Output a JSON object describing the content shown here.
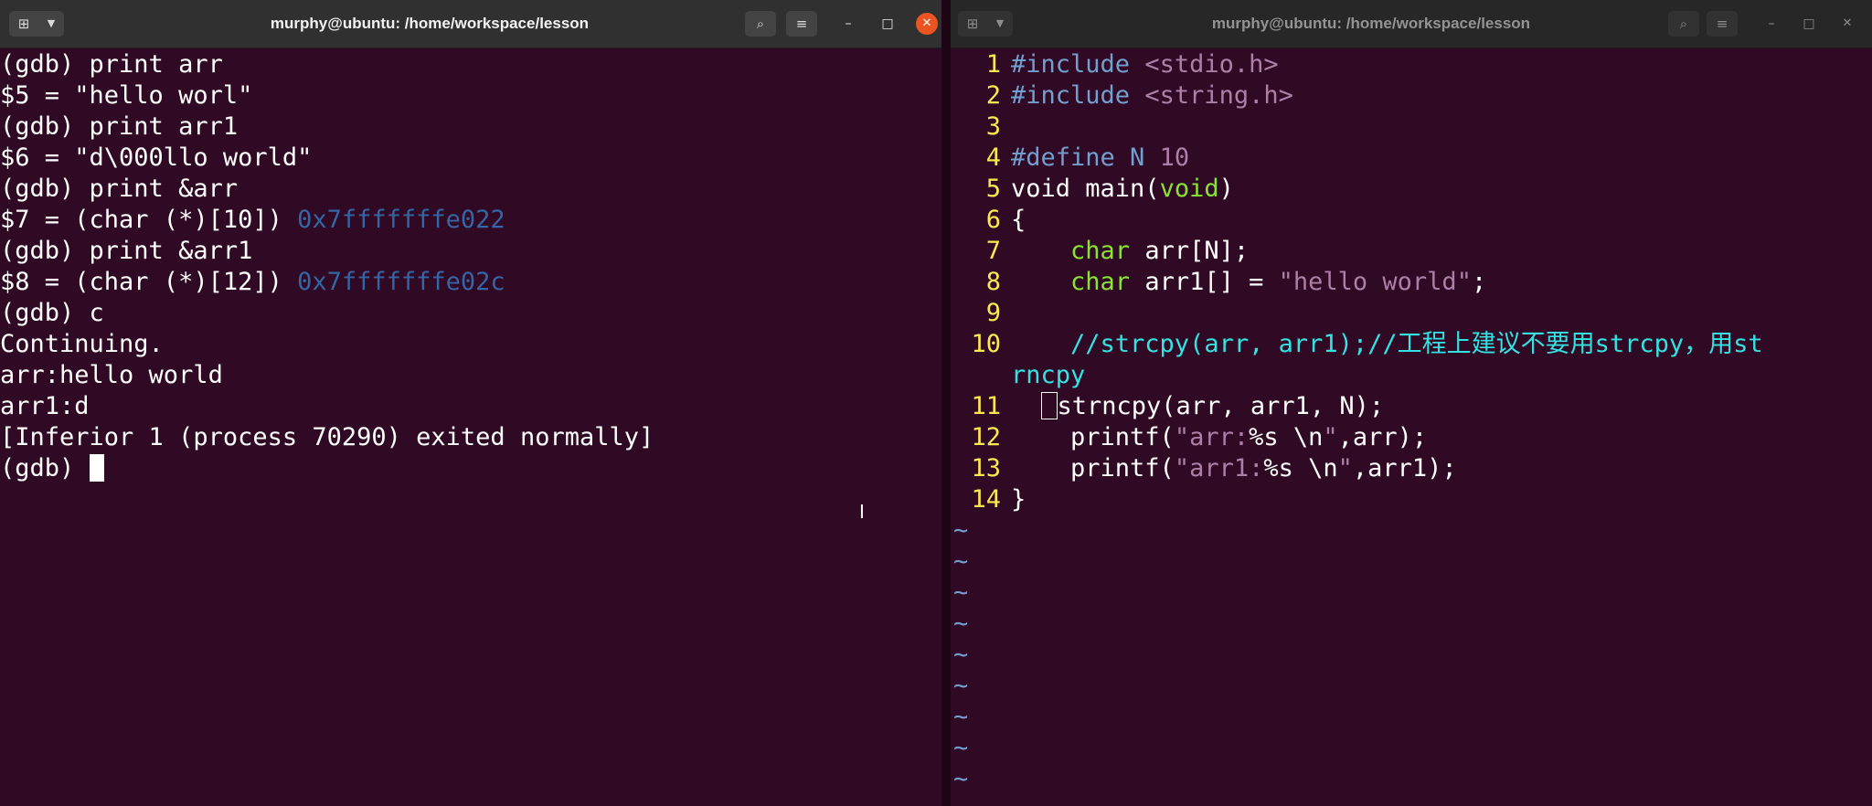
{
  "left_window": {
    "title": "murphy@ubuntu: /home/workspace/lesson",
    "buttons": {
      "new_tab_icon": "new-tab-icon",
      "menu_arrow_icon": "chevron-down-icon",
      "search_icon": "search-icon",
      "hamburger_icon": "hamburger-menu-icon",
      "minimize": "–",
      "maximize": "□",
      "close": "✕"
    },
    "terminal_lines": [
      {
        "text": "(gdb) print arr"
      },
      {
        "text": "$5 = \"hello worl\""
      },
      {
        "text": "(gdb) print arr1"
      },
      {
        "text": "$6 = \"d\\000llo world\""
      },
      {
        "text": "(gdb) print &arr"
      },
      {
        "text": "$7 = (char (*)[10]) ",
        "addr": "0x7fffffffe022"
      },
      {
        "text": "(gdb) print &arr1"
      },
      {
        "text": "$8 = (char (*)[12]) ",
        "addr": "0x7fffffffe02c"
      },
      {
        "text": "(gdb) c"
      },
      {
        "text": "Continuing."
      },
      {
        "text": "arr:hello world"
      },
      {
        "text": "arr1:d"
      },
      {
        "text": "[Inferior 1 (process 70290) exited normally]"
      }
    ],
    "prompt": "(gdb) "
  },
  "right_window": {
    "title": "murphy@ubuntu: /home/workspace/lesson",
    "buttons": {
      "minimize": "–",
      "maximize": "□",
      "close": "✕"
    },
    "code_lines": [
      {
        "num": "1",
        "segments": [
          {
            "cls": "pp",
            "t": "#include "
          },
          {
            "cls": "str",
            "t": "<stdio.h>"
          }
        ]
      },
      {
        "num": "2",
        "segments": [
          {
            "cls": "pp",
            "t": "#include "
          },
          {
            "cls": "str",
            "t": "<string.h>"
          }
        ]
      },
      {
        "num": "3",
        "segments": []
      },
      {
        "num": "4",
        "segments": [
          {
            "cls": "pp",
            "t": "#define N "
          },
          {
            "cls": "str",
            "t": "10"
          }
        ]
      },
      {
        "num": "5",
        "segments": [
          {
            "cls": "",
            "t": "void main("
          },
          {
            "cls": "kw",
            "t": "void"
          },
          {
            "cls": "",
            "t": ")"
          }
        ]
      },
      {
        "num": "6",
        "segments": [
          {
            "cls": "",
            "t": "{"
          }
        ]
      },
      {
        "num": "7",
        "segments": [
          {
            "cls": "",
            "t": "    "
          },
          {
            "cls": "kw",
            "t": "char"
          },
          {
            "cls": "",
            "t": " arr[N];"
          }
        ]
      },
      {
        "num": "8",
        "segments": [
          {
            "cls": "",
            "t": "    "
          },
          {
            "cls": "kw",
            "t": "char"
          },
          {
            "cls": "",
            "t": " arr1[] = "
          },
          {
            "cls": "str",
            "t": "\"hello world\""
          },
          {
            "cls": "",
            "t": ";"
          }
        ]
      },
      {
        "num": "9",
        "segments": []
      },
      {
        "num": "10",
        "segments": [
          {
            "cls": "cmt",
            "t": "    //strcpy(arr, arr1);//工程上建议不要用strcpy，用st"
          }
        ]
      },
      {
        "num": "",
        "segments": [
          {
            "cls": "cmt",
            "t": "rncpy"
          }
        ]
      },
      {
        "num": "11",
        "cursor": true,
        "segments": [
          {
            "cls": "",
            "t": "strncpy(arr, arr1, N);"
          }
        ]
      },
      {
        "num": "12",
        "segments": [
          {
            "cls": "",
            "t": "    printf("
          },
          {
            "cls": "str",
            "t": "\"arr:"
          },
          {
            "cls": "",
            "t": "%s \\n"
          },
          {
            "cls": "str",
            "t": "\""
          },
          {
            "cls": "",
            "t": ",arr);"
          }
        ]
      },
      {
        "num": "13",
        "segments": [
          {
            "cls": "",
            "t": "    printf("
          },
          {
            "cls": "str",
            "t": "\"arr1:"
          },
          {
            "cls": "",
            "t": "%s \\n"
          },
          {
            "cls": "str",
            "t": "\""
          },
          {
            "cls": "",
            "t": ",arr1);"
          }
        ]
      },
      {
        "num": "14",
        "segments": [
          {
            "cls": "",
            "t": "}"
          }
        ]
      }
    ],
    "tilde_lines": [
      "~",
      "~",
      "~",
      "~",
      "~",
      "~",
      "~",
      "~",
      "~"
    ]
  },
  "colors": {
    "terminal_bg": "#300a24",
    "address_blue": "#3465a4",
    "line_number_yellow": "#fce94f",
    "close_orange": "#e95420"
  }
}
